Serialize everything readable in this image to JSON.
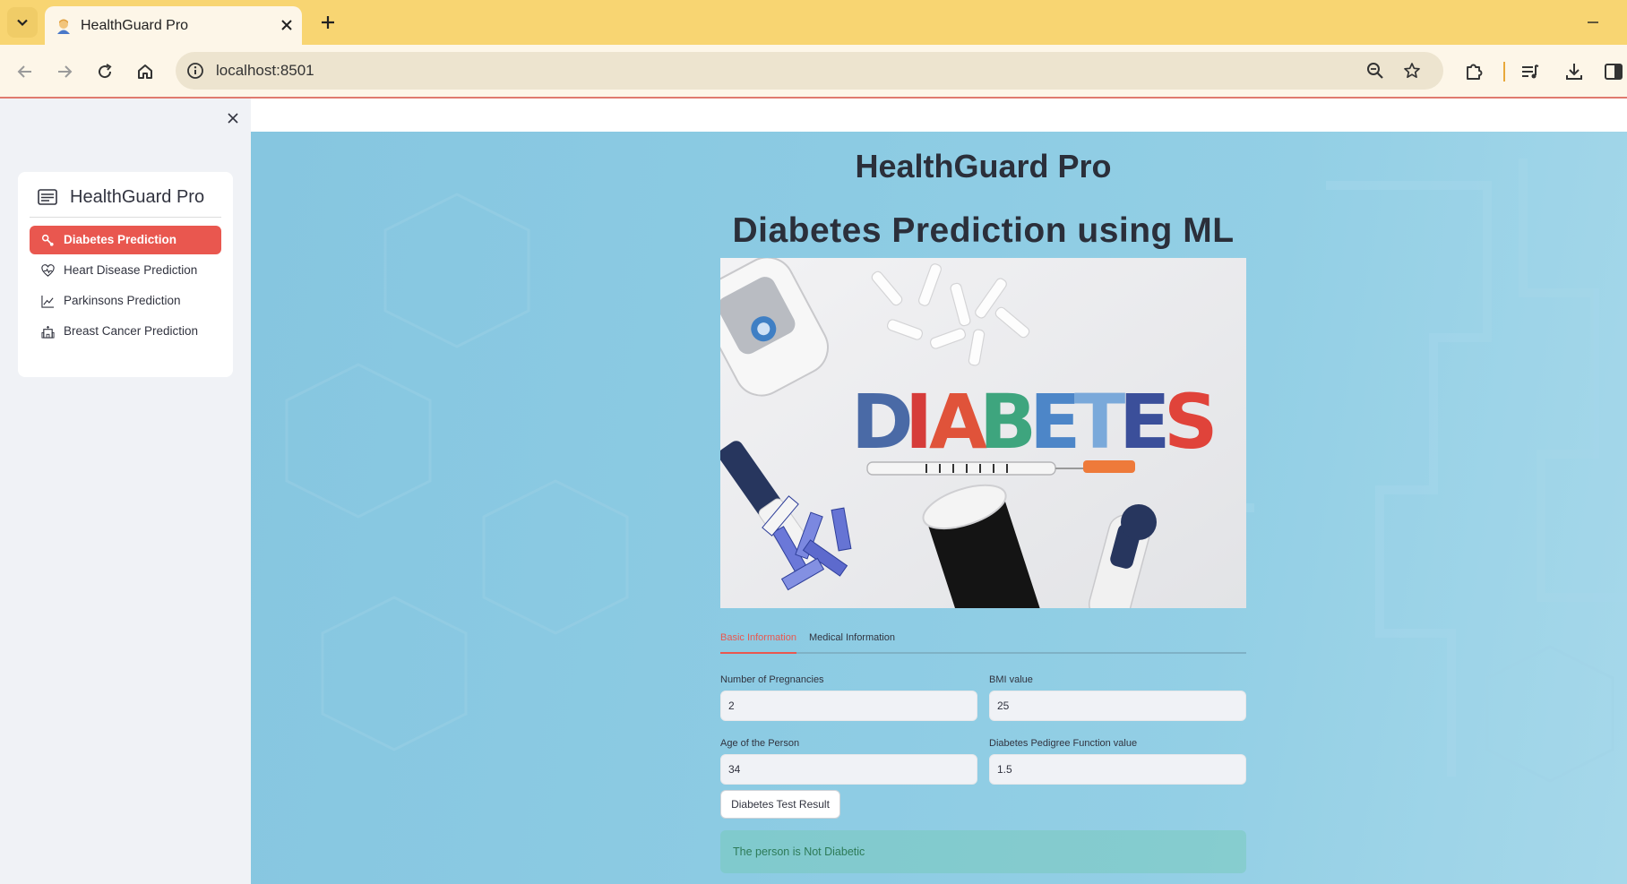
{
  "browser": {
    "tab_title": "HealthGuard Pro",
    "url": "localhost:8501",
    "favicon": "person-emoji-icon",
    "accent_color": "#f8d572"
  },
  "sidebar": {
    "title": "HealthGuard Pro",
    "items": [
      {
        "label": "Diabetes Prediction",
        "icon": "activity-icon",
        "active": true
      },
      {
        "label": "Heart Disease Prediction",
        "icon": "heart-pulse-icon",
        "active": false
      },
      {
        "label": "Parkinsons Prediction",
        "icon": "graph-up-icon",
        "active": false
      },
      {
        "label": "Breast Cancer Prediction",
        "icon": "hospital-icon",
        "active": false
      }
    ],
    "active_color": "#e9574f"
  },
  "main": {
    "app_title": "HealthGuard Pro",
    "page_title": "Diabetes Prediction using ML",
    "hero_image": {
      "word": "DIABETES"
    },
    "tabs": [
      {
        "label": "Basic Information",
        "active": true
      },
      {
        "label": "Medical Information",
        "active": false
      }
    ],
    "fields": {
      "pregnancies": {
        "label": "Number of Pregnancies",
        "value": "2"
      },
      "bmi": {
        "label": "BMI value",
        "value": "25"
      },
      "age": {
        "label": "Age of the Person",
        "value": "34"
      },
      "dpf": {
        "label": "Diabetes Pedigree Function value",
        "value": "1.5"
      }
    },
    "result_button": "Diabetes Test Result",
    "result_message": "The person is Not Diabetic"
  }
}
